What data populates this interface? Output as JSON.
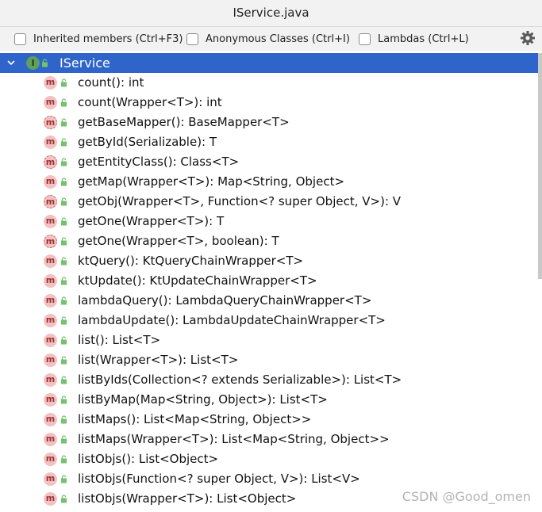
{
  "window": {
    "title": "IService.java"
  },
  "toolbar": {
    "inherited": "Inherited members (Ctrl+F3)",
    "anonymous": "Anonymous Classes (Ctrl+I)",
    "lambdas": "Lambdas (Ctrl+L)",
    "settings_icon": "gear-icon"
  },
  "tree": {
    "root": {
      "label": "IService",
      "badge": "I"
    },
    "items": [
      {
        "label": "count(): int",
        "default": false
      },
      {
        "label": "count(Wrapper<T>): int",
        "default": false
      },
      {
        "label": "getBaseMapper(): BaseMapper<T>",
        "default": true
      },
      {
        "label": "getById(Serializable): T",
        "default": false
      },
      {
        "label": "getEntityClass(): Class<T>",
        "default": true
      },
      {
        "label": "getMap(Wrapper<T>): Map<String, Object>",
        "default": false
      },
      {
        "label": "getObj(Wrapper<T>, Function<? super Object, V>): V",
        "default": true
      },
      {
        "label": "getOne(Wrapper<T>): T",
        "default": false
      },
      {
        "label": "getOne(Wrapper<T>, boolean): T",
        "default": true
      },
      {
        "label": "ktQuery(): KtQueryChainWrapper<T>",
        "default": false
      },
      {
        "label": "ktUpdate(): KtUpdateChainWrapper<T>",
        "default": false
      },
      {
        "label": "lambdaQuery(): LambdaQueryChainWrapper<T>",
        "default": false
      },
      {
        "label": "lambdaUpdate(): LambdaUpdateChainWrapper<T>",
        "default": false
      },
      {
        "label": "list(): List<T>",
        "default": false
      },
      {
        "label": "list(Wrapper<T>): List<T>",
        "default": false
      },
      {
        "label": "listByIds(Collection<? extends Serializable>): List<T>",
        "default": false
      },
      {
        "label": "listByMap(Map<String, Object>): List<T>",
        "default": false
      },
      {
        "label": "listMaps(): List<Map<String, Object>>",
        "default": false
      },
      {
        "label": "listMaps(Wrapper<T>): List<Map<String, Object>>",
        "default": false
      },
      {
        "label": "listObjs(): List<Object>",
        "default": false
      },
      {
        "label": "listObjs(Function<? super Object, V>): List<V>",
        "default": false
      },
      {
        "label": "listObjs(Wrapper<T>): List<Object>",
        "default": false
      }
    ],
    "method_badge": "m"
  },
  "watermark": "CSDN @Good_omen"
}
